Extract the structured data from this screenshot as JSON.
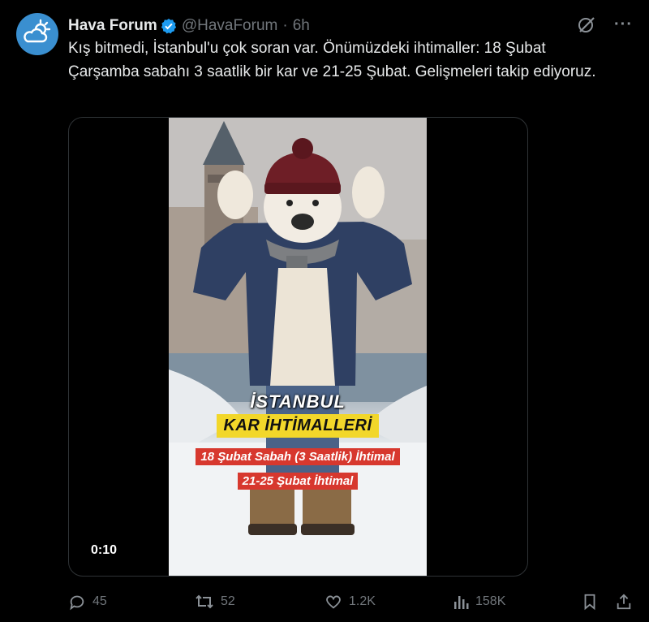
{
  "tweet": {
    "author_name": "Hava Forum",
    "handle": "@HavaForum",
    "separator": "·",
    "time": "6h",
    "text": "Kış bitmedi, İstanbul'u çok soran var. Önümüzdeki ihtimaller: 18 Şubat Çarşamba sabahı 3 saatlik bir kar ve 21-25 Şubat. Gelişmeleri takip ediyoruz.",
    "more_label": "···"
  },
  "media": {
    "duration": "0:10",
    "overlay": {
      "line1": "İSTANBUL",
      "line2": "KAR İHTİMALLERİ",
      "line3": "18 Şubat Sabah (3 Saatlik) İhtimal",
      "line4": "21-25 Şubat İhtimal"
    }
  },
  "actions": {
    "replies": "45",
    "reposts": "52",
    "likes": "1.2K",
    "views": "158K"
  },
  "colors": {
    "background": "#000000",
    "text": "#e7e9ea",
    "muted": "#71767b",
    "verified": "#1d9bf0",
    "highlight_yellow": "#f2d72a",
    "highlight_red": "#d7382e"
  },
  "icons": [
    "cloud-sun-logo-icon",
    "verified-badge-icon",
    "grok-icon",
    "more-icon",
    "reply-icon",
    "repost-icon",
    "like-icon",
    "views-icon",
    "bookmark-icon",
    "share-icon"
  ]
}
